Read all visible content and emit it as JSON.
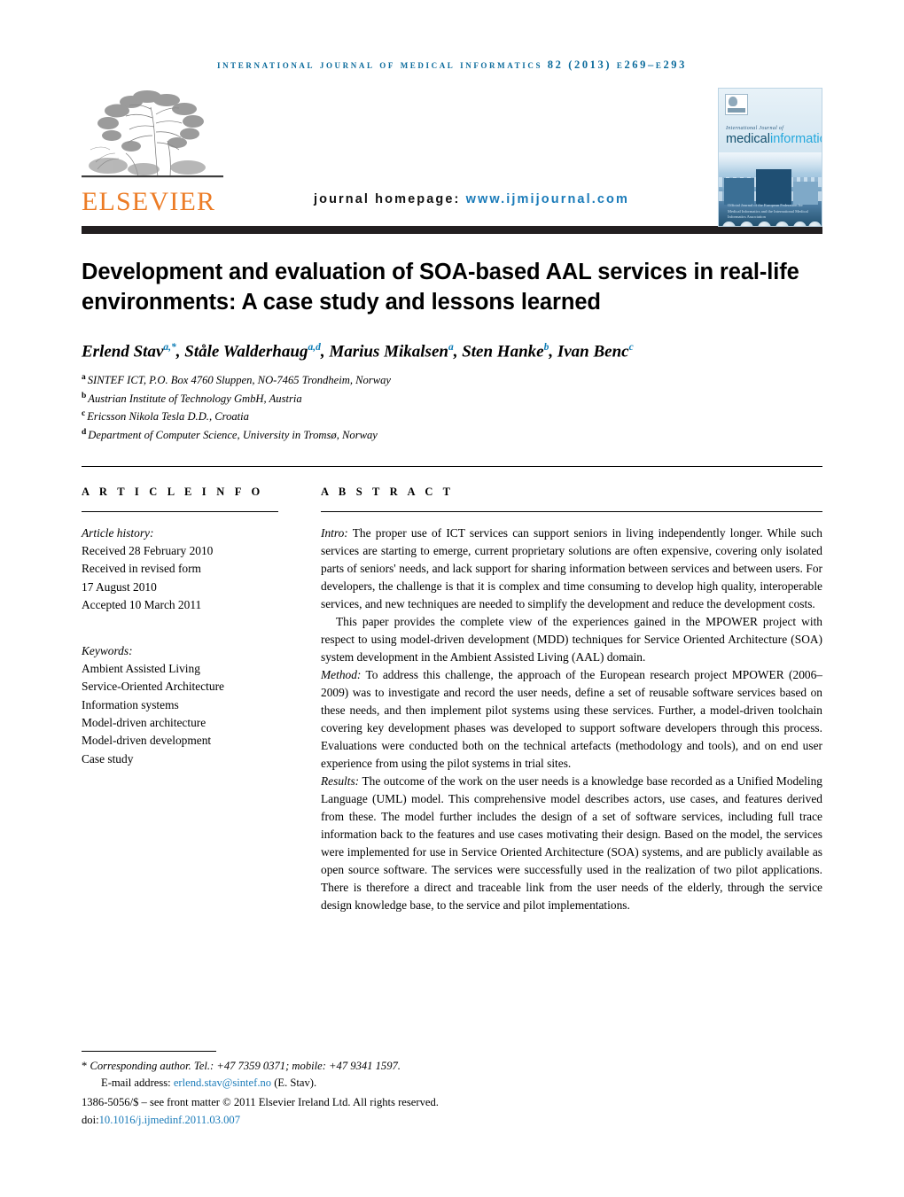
{
  "running_head": "international journal of medical informatics 82 (2013) e269–e293",
  "masthead": {
    "publisher_wordmark": "ELSEVIER",
    "homepage_label": "journal homepage:",
    "homepage_url": "www.ijmijournal.com",
    "cover": {
      "supertitle": "International Journal of",
      "title_part1": "medical",
      "title_part2": "informatics",
      "caption": "Official Journal of the European Federation for Medical Informatics and the International Medical Informatics Association"
    },
    "accent_color": "#1a7bb9",
    "wordmark_color": "#ec7c26",
    "rule_color": "#231f20"
  },
  "title": "Development and evaluation of SOA-based AAL services in real-life environments: A case study and lessons learned",
  "authors": [
    {
      "name": "Erlend Stav",
      "marks": "a,*"
    },
    {
      "name": "Ståle Walderhaug",
      "marks": "a,d"
    },
    {
      "name": "Marius Mikalsen",
      "marks": "a"
    },
    {
      "name": "Sten Hanke",
      "marks": "b"
    },
    {
      "name": "Ivan Benc",
      "marks": "c"
    }
  ],
  "affiliations": [
    {
      "mark": "a",
      "text": "SINTEF ICT, P.O. Box 4760 Sluppen, NO-7465 Trondheim, Norway"
    },
    {
      "mark": "b",
      "text": "Austrian Institute of Technology GmbH, Austria"
    },
    {
      "mark": "c",
      "text": "Ericsson Nikola Tesla D.D., Croatia"
    },
    {
      "mark": "d",
      "text": "Department of Computer Science, University in Tromsø, Norway"
    }
  ],
  "article_info": {
    "heading": "A R T I C L E   I N F O",
    "history_label": "Article history:",
    "history": [
      "Received 28 February 2010",
      "Received in revised form",
      "17 August 2010",
      "Accepted 10 March 2011"
    ],
    "keywords_label": "Keywords:",
    "keywords": [
      "Ambient Assisted Living",
      "Service-Oriented Architecture",
      "Information systems",
      "Model-driven architecture",
      "Model-driven development",
      "Case study"
    ]
  },
  "abstract": {
    "heading": "A B S T R A C T",
    "paragraphs": [
      {
        "run_in": "Intro:",
        "indent": false,
        "text": " The proper use of ICT services can support seniors in living independently longer. While such services are starting to emerge, current proprietary solutions are often expensive, covering only isolated parts of seniors' needs, and lack support for sharing information between services and between users. For developers, the challenge is that it is complex and time consuming to develop high quality, interoperable services, and new techniques are needed to simplify the development and reduce the development costs."
      },
      {
        "run_in": "",
        "indent": true,
        "text": "This paper provides the complete view of the experiences gained in the MPOWER project with respect to using model-driven development (MDD) techniques for Service Oriented Architecture (SOA) system development in the Ambient Assisted Living (AAL) domain."
      },
      {
        "run_in": "Method:",
        "indent": false,
        "text": " To address this challenge, the approach of the European research project MPOWER (2006–2009) was to investigate and record the user needs, define a set of reusable software services based on these needs, and then implement pilot systems using these services. Further, a model-driven toolchain covering key development phases was developed to support software developers through this process. Evaluations were conducted both on the technical artefacts (methodology and tools), and on end user experience from using the pilot systems in trial sites."
      },
      {
        "run_in": "Results:",
        "indent": false,
        "text": " The outcome of the work on the user needs is a knowledge base recorded as a Unified Modeling Language (UML) model. This comprehensive model describes actors, use cases, and features derived from these. The model further includes the design of a set of software services, including full trace information back to the features and use cases motivating their design. Based on the model, the services were implemented for use in Service Oriented Architecture (SOA) systems, and are publicly available as open source software. The services were successfully used in the realization of two pilot applications. There is therefore a direct and traceable link from the user needs of the elderly, through the service design knowledge base, to the service and pilot implementations."
      }
    ]
  },
  "footnotes": {
    "corresponding": "Corresponding author. Tel.: +47 7359 0371; mobile: +47 9341 1597.",
    "corresponding_marker": "*",
    "email_label": "E-mail address:",
    "email": "erlend.stav@sintef.no",
    "email_suffix": "(E. Stav).",
    "copyright": "1386-5056/$ – see front matter © 2011 Elsevier Ireland Ltd. All rights reserved.",
    "doi_label": "doi:",
    "doi": "10.1016/j.ijmedinf.2011.03.007"
  }
}
